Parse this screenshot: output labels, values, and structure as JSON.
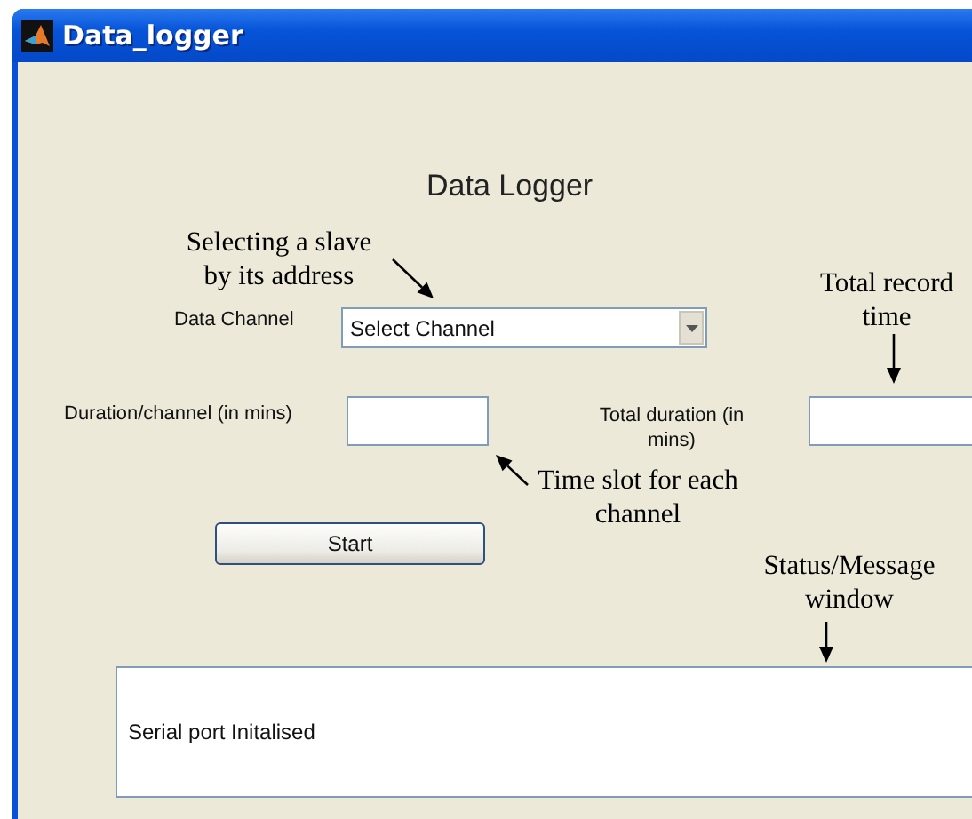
{
  "window": {
    "title": "Data_logger"
  },
  "heading": "Data Logger",
  "data_channel": {
    "label": "Data Channel",
    "value": "Select Channel"
  },
  "duration_per_channel": {
    "label": "Duration/channel (in mins)"
  },
  "total_duration": {
    "label": "Total duration (in mins)"
  },
  "start_button": "Start",
  "message_window": {
    "text": "Serial port Initalised"
  },
  "annotations": [
    {
      "text": "Selecting a slave by its address"
    },
    {
      "text": "Total record time"
    },
    {
      "text": "Time slot for each channel"
    },
    {
      "text": "Status/Message window"
    }
  ]
}
